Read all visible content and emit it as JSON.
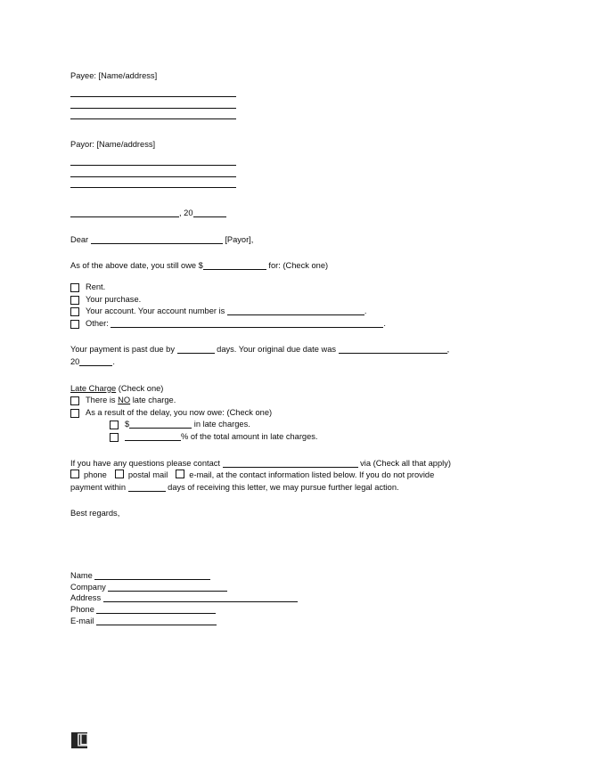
{
  "document": {
    "type": "past-due-payment-demand-letter",
    "payee": {
      "label": "Payee: [Name/address]",
      "rule_count": 3
    },
    "payor": {
      "label": "Payor: [Name/address]",
      "rule_count": 3
    },
    "date_line": {
      "comma": ", ",
      "year_prefix": "20"
    },
    "salutation": {
      "dear": "Dear ",
      "recipient": " [Payor],"
    },
    "owed_line": {
      "before": "As of the above date, you still owe $",
      "after": " for: (Check one)"
    },
    "reason_options": [
      {
        "label": "Rent.",
        "has_rule": false
      },
      {
        "label": "Your purchase.",
        "has_rule": false
      },
      {
        "label": "Your account. Your account number is ",
        "has_rule": true,
        "trailing": "."
      },
      {
        "label": "Other: ",
        "has_rule": true,
        "trailing": "."
      }
    ],
    "past_due": {
      "part1": "Your payment is past due by ",
      "part2": " days. Your original due date was ",
      "part3": ",",
      "part4": "20",
      "part5": "."
    },
    "late_charge": {
      "heading": "Late Charge",
      "heading_suffix": " (Check one)",
      "option_no": {
        "before": "There is ",
        "emphasis": "NO",
        "after": " late charge."
      },
      "option_delay": "As a result of the delay, you now owe: (Check one)",
      "sub_options": [
        {
          "prefix": "$",
          "suffix": " in late charges."
        },
        {
          "prefix": "",
          "suffix": "% of the total amount in late charges."
        }
      ]
    },
    "contact": {
      "line1_before": "If you have any questions please contact ",
      "line1_after": " via (Check all that apply)",
      "methods": [
        "phone",
        "postal mail",
        "e-mail,"
      ],
      "line2_after": " at the contact information listed below. If you do not provide",
      "line3_before": "payment within ",
      "line3_after": " days of receiving this letter, we may pursue further legal action."
    },
    "closing": "Best regards,",
    "signature_fields": [
      {
        "label": "Name "
      },
      {
        "label": "Company "
      },
      {
        "label": "Address "
      },
      {
        "label": "Phone "
      },
      {
        "label": "E-mail "
      }
    ]
  },
  "branding": {
    "logo_name": "legal-templates-logo",
    "logo_color": "#262626",
    "logo_accent": "#e8e8e8"
  },
  "colors": {
    "text": "#0d0d0d",
    "rule": "#0f0f0f",
    "background": "#ffffff"
  }
}
